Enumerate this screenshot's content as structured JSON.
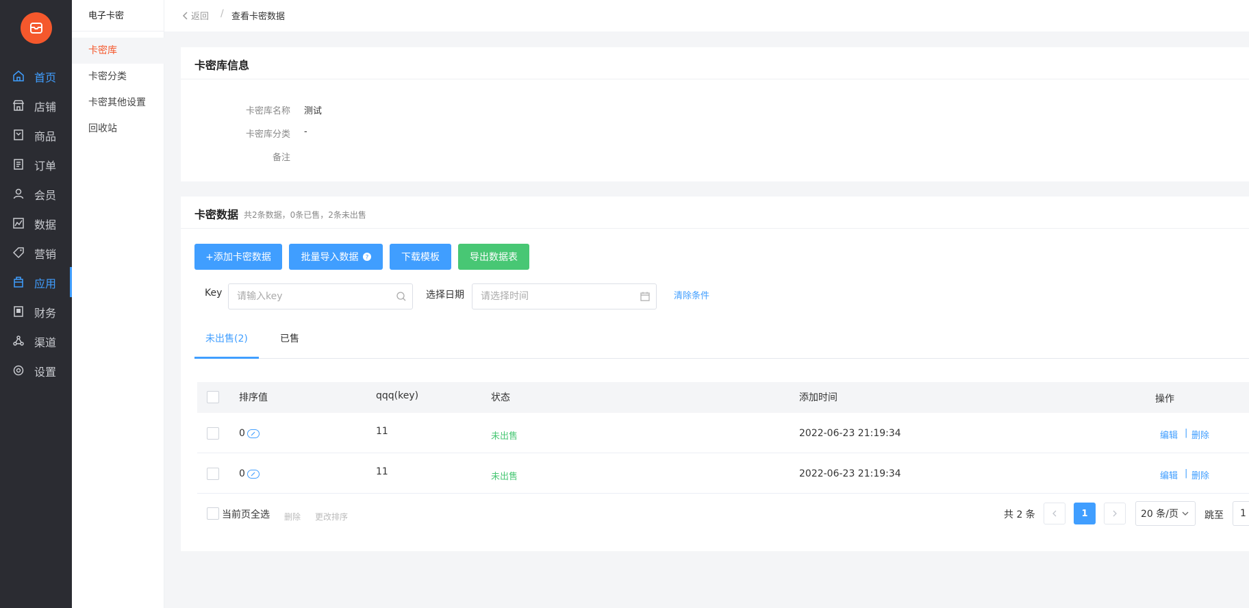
{
  "nav": {
    "items": [
      {
        "label": "首页",
        "icon": "home-icon"
      },
      {
        "label": "店铺",
        "icon": "store-icon"
      },
      {
        "label": "商品",
        "icon": "goods-icon"
      },
      {
        "label": "订单",
        "icon": "order-icon"
      },
      {
        "label": "会员",
        "icon": "user-icon"
      },
      {
        "label": "数据",
        "icon": "chart-icon"
      },
      {
        "label": "营销",
        "icon": "tag-icon"
      },
      {
        "label": "应用",
        "icon": "app-icon"
      },
      {
        "label": "财务",
        "icon": "finance-icon"
      },
      {
        "label": "渠道",
        "icon": "channel-icon"
      },
      {
        "label": "设置",
        "icon": "gear-icon"
      }
    ],
    "active": "应用",
    "accent_color": "#409eff",
    "logo_color": "#f5582c"
  },
  "subnav": {
    "title": "电子卡密",
    "items": [
      "卡密库",
      "卡密分类",
      "卡密其他设置",
      "回收站"
    ],
    "active": "卡密库"
  },
  "breadcrumb": {
    "back": "返回",
    "separator": "/",
    "current": "查看卡密数据"
  },
  "info_card": {
    "title": "卡密库信息",
    "fields": [
      {
        "label": "卡密库名称",
        "value": "测试"
      },
      {
        "label": "卡密库分类",
        "value": "-"
      },
      {
        "label": "备注",
        "value": ""
      }
    ]
  },
  "data_card": {
    "title": "卡密数据",
    "summary": "共2条数据，0条已售，2条未出售",
    "buttons": {
      "add": "+添加卡密数据",
      "import": "批量导入数据",
      "template": "下载模板",
      "export": "导出数据表"
    },
    "filters": {
      "key_label": "Key",
      "key_placeholder": "请输入key",
      "date_label": "选择日期",
      "date_placeholder": "请选择时间",
      "clear": "清除条件"
    },
    "tabs": [
      "未出售(2)",
      "已售"
    ],
    "active_tab": "未出售(2)",
    "table": {
      "columns": [
        "排序值",
        "qqq(key)",
        "状态",
        "添加时间",
        "操作"
      ],
      "rows": [
        {
          "sort": "0",
          "key": "11",
          "status": "未出售",
          "time": "2022-06-23 21:19:34",
          "edit": "编辑",
          "sep": "|",
          "delete": "删除"
        },
        {
          "sort": "0",
          "key": "11",
          "status": "未出售",
          "time": "2022-06-23 21:19:34",
          "edit": "编辑",
          "sep": "|",
          "delete": "删除"
        }
      ]
    },
    "footer": {
      "select_all": "当前页全选",
      "batch_delete": "删除",
      "change_sort": "更改排序"
    },
    "pagination": {
      "total": "共 2 条",
      "current_page": "1",
      "page_size": "20 条/页",
      "jump_label": "跳至",
      "jump_value": "1"
    }
  }
}
